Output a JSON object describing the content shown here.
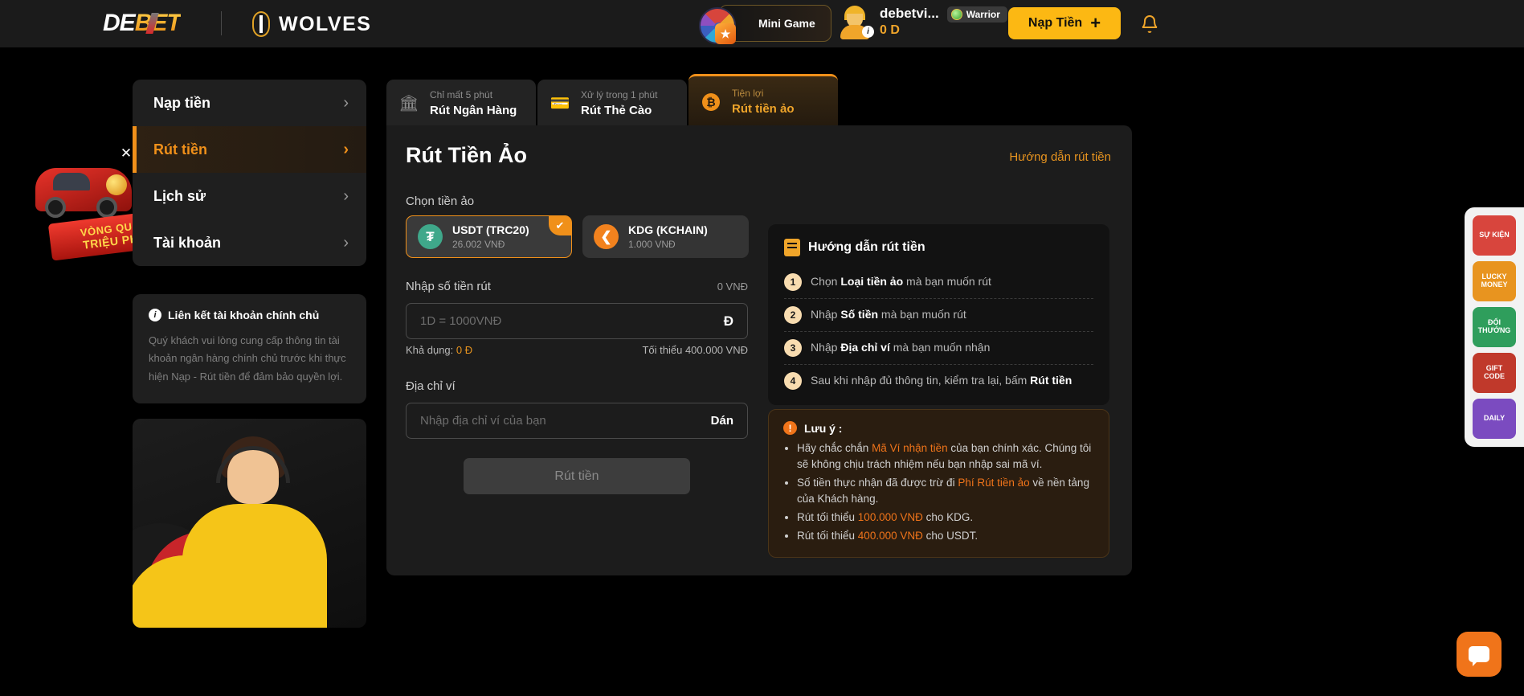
{
  "header": {
    "logo_de": "DE",
    "logo_bet": "BET",
    "partner": "WOLVES",
    "minigame_label": "Mini Game",
    "username": "debetvi...",
    "balance": "0 D",
    "rank_label": "Warrior",
    "deposit_label": "Nạp Tiền",
    "deposit_plus": "+",
    "bell_icon": "bell-icon"
  },
  "promo": {
    "line1": "VÒNG QUAY",
    "line2": "TRIỆU PHÚ",
    "close": "✕"
  },
  "sidebar": {
    "items": [
      {
        "label": "Nạp tiền",
        "active": false
      },
      {
        "label": "Rút tiền",
        "active": true
      },
      {
        "label": "Lịch sử",
        "active": false
      },
      {
        "label": "Tài khoản",
        "active": false
      }
    ],
    "chevron": "›",
    "linkbox": {
      "title": "Liên kết tài khoản chính chủ",
      "body": "Quý khách vui lòng cung cấp thông tin tài khoản ngân hàng chính chủ trước khi thực hiện Nạp - Rút tiền để đảm bảo quyền lợi."
    }
  },
  "tabs": [
    {
      "sub": "Chỉ mất 5 phút",
      "main": "Rút Ngân Hàng",
      "icon": "bank-icon",
      "active": false
    },
    {
      "sub": "Xử lý trong 1 phút",
      "main": "Rút Thẻ Cào",
      "icon": "card-icon",
      "active": false
    },
    {
      "sub": "Tiện lợi",
      "main": "Rút tiền ảo",
      "icon": "bitcoin-icon",
      "active": true
    }
  ],
  "main": {
    "title": "Rút Tiền Ảo",
    "guide_link": "Hướng dẫn rút tiền",
    "choose_coin_label": "Chọn tiền ảo",
    "coins": [
      {
        "name": "USDT (TRC20)",
        "rate": "26.002 VNĐ",
        "symbol": "₮",
        "color": "#3fa88a",
        "selected": true
      },
      {
        "name": "KDG (KCHAIN)",
        "rate": "1.000 VNĐ",
        "symbol": "❮",
        "color": "#f2821e",
        "selected": false
      }
    ],
    "amount_label": "Nhập số tiền rút",
    "amount_converted": "0 VNĐ",
    "amount_placeholder": "1D = 1000VNĐ",
    "amount_unit": "Ð",
    "available_prefix": "Khả dụng: ",
    "available_value": "0 Ð",
    "minimum": "Tối thiểu 400.000 VNĐ",
    "wallet_label": "Địa chỉ ví",
    "wallet_placeholder": "Nhập địa chỉ ví của bạn",
    "paste_label": "Dán",
    "submit_label": "Rút tiền"
  },
  "guide": {
    "title": "Hướng dẫn rút tiền",
    "steps": [
      {
        "num": "1",
        "pre": "Chọn ",
        "bold": "Loại tiền ảo",
        "post": " mà bạn muốn rút"
      },
      {
        "num": "2",
        "pre": "Nhập ",
        "bold": "Số tiền",
        "post": " mà bạn muốn rút"
      },
      {
        "num": "3",
        "pre": "Nhập ",
        "bold": "Địa chỉ ví",
        "post": " mà bạn muốn nhận"
      },
      {
        "num": "4",
        "pre": "Sau khi nhập đủ thông tin, kiểm tra lại, bấm ",
        "bold": "Rút tiền",
        "post": ""
      }
    ]
  },
  "note": {
    "title": "Lưu ý :",
    "items": [
      {
        "a": "Hãy chắc chắn ",
        "hl": "Mã Ví nhận tiền",
        "b": " của bạn chính xác. Chúng tôi sẽ không chịu trách nhiệm nếu bạn nhập sai mã ví."
      },
      {
        "a": "Số tiền thực nhận đã được trừ đi ",
        "hl": "Phí Rút tiền ảo",
        "b": " về nền tảng của Khách hàng."
      },
      {
        "a": "Rút tối thiểu ",
        "hl": "100.000 VNĐ",
        "b": " cho KDG."
      },
      {
        "a": "Rút tối thiểu ",
        "hl": "400.000 VNĐ",
        "b": " cho USDT."
      }
    ]
  },
  "rail": [
    {
      "label": "SỰ KIỆN",
      "color": "#d8453d",
      "icon": "event-icon"
    },
    {
      "label": "LUCKY MONEY",
      "color": "#e8941f",
      "icon": "lucky-money-icon"
    },
    {
      "label": "ĐỔI THƯỞNG",
      "color": "#2f9e5c",
      "icon": "reward-icon"
    },
    {
      "label": "GIFT CODE",
      "color": "#c0392b",
      "icon": "giftcode-icon"
    },
    {
      "label": "DAILY",
      "color": "#7b4bc0",
      "icon": "daily-icon"
    }
  ],
  "chat": {
    "icon": "chat-icon"
  }
}
